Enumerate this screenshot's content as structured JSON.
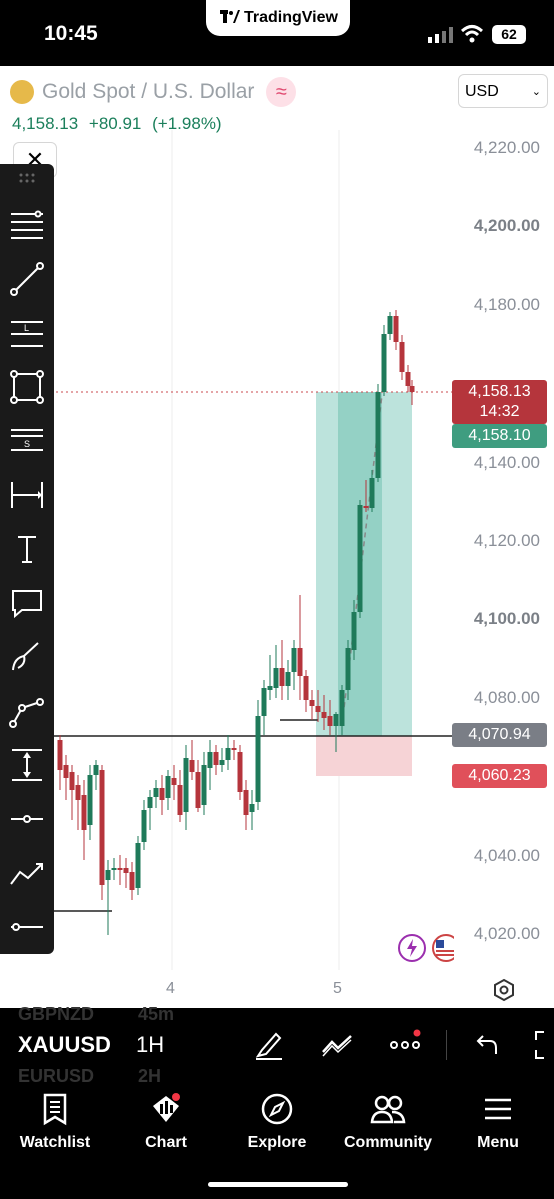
{
  "status_bar": {
    "time": "10:45",
    "app": "TradingView",
    "battery": "62"
  },
  "header": {
    "title": "Gold Spot / U.S. Dollar",
    "badge": "≈",
    "price": "4,158.13",
    "change": "+80.91",
    "change_pct": "(+1.98%)",
    "currency": "USD",
    "close": "✕"
  },
  "price_axis": {
    "labels": [
      "4,220.00",
      "4,200.00",
      "4,180.00",
      "4,140.00",
      "4,120.00",
      "4,100.00",
      "4,080.00",
      "4,040.00",
      "4,020.00"
    ],
    "current": "4,158.13",
    "countdown": "14:32",
    "target": "4,158.10",
    "entry": "4,070.94",
    "stop": "4,060.23"
  },
  "time_axis": {
    "labels": [
      "4",
      "5"
    ]
  },
  "toolbar": {
    "tools": [
      "lines-tool-icon",
      "trendline-icon",
      "fib-icon",
      "rectangle-icon",
      "pattern-icon",
      "measure-icon",
      "text-icon",
      "callout-icon",
      "brush-icon",
      "path-icon",
      "long-position-icon",
      "horizontal-ray-icon",
      "forecast-icon",
      "horizontal-line-icon"
    ]
  },
  "symbol_bar": {
    "symbol": "XAUUSD",
    "timeframe": "1H",
    "ghost_above": [
      "GBPNZD",
      "45m"
    ],
    "ghost_below": [
      "EURUSD",
      "2H"
    ]
  },
  "nav": {
    "items": [
      {
        "label": "Watchlist"
      },
      {
        "label": "Chart"
      },
      {
        "label": "Explore"
      },
      {
        "label": "Community"
      },
      {
        "label": "Menu"
      }
    ]
  },
  "colors": {
    "up": "#1f7a5a",
    "down": "#b5353c",
    "target_zone": "#8fd0c4",
    "stop_zone": "#f6d3d6"
  }
}
